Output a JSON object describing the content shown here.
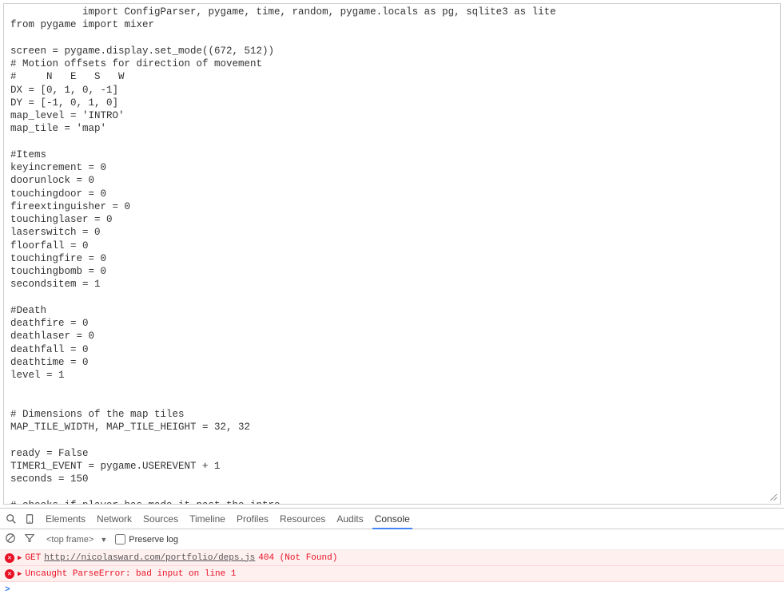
{
  "code": "            import ConfigParser, pygame, time, random, pygame.locals as pg, sqlite3 as lite\nfrom pygame import mixer\n\nscreen = pygame.display.set_mode((672, 512))\n# Motion offsets for direction of movement\n#     N   E   S   W\nDX = [0, 1, 0, -1]\nDY = [-1, 0, 1, 0]\nmap_level = 'INTRO'\nmap_tile = 'map'\n\n#Items\nkeyincrement = 0\ndoorunlock = 0\ntouchingdoor = 0\nfireextinguisher = 0\ntouchinglaser = 0\nlaserswitch = 0\nfloorfall = 0\ntouchingfire = 0\ntouchingbomb = 0\nsecondsitem = 1\n\n#Death\ndeathfire = 0\ndeathlaser = 0\ndeathfall = 0\ndeathtime = 0\nlevel = 1\n\n\n# Dimensions of the map tiles\nMAP_TILE_WIDTH, MAP_TILE_HEIGHT = 32, 32\n\nready = False\nTIMER1_EVENT = pygame.USEREVENT + 1\nseconds = 150\n\n# checks if player has made it past the intro\nisPastIntro = False",
  "tabs": {
    "elements": "Elements",
    "network": "Network",
    "sources": "Sources",
    "timeline": "Timeline",
    "profiles": "Profiles",
    "resources": "Resources",
    "audits": "Audits",
    "console": "Console"
  },
  "toolbar": {
    "frame": "<top frame>",
    "preserve_log": "Preserve log"
  },
  "console": {
    "msg1": {
      "method": "GET",
      "url": "http://nicolasward.com/portfolio/deps.js",
      "status": "404 (Not Found)"
    },
    "msg2": {
      "text": "Uncaught ParseError: bad input on line 1"
    },
    "prompt": ">"
  }
}
